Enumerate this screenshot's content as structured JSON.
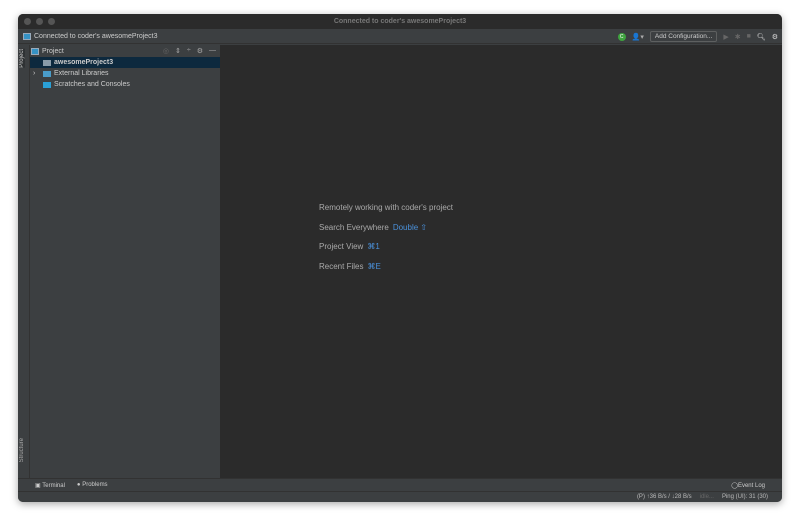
{
  "window": {
    "title": "Connected to coder's awesomeProject3"
  },
  "toolbar": {
    "project_label": "Connected to coder's awesomeProject3",
    "status_letter": "C",
    "add_configuration": "Add Configuration..."
  },
  "left_stripe": {
    "project_tab": "Project",
    "structure_tab": "Structure"
  },
  "project_panel": {
    "title": "Project",
    "items": [
      {
        "label": "awesomeProject3"
      },
      {
        "label": "External Libraries"
      },
      {
        "label": "Scratches and Consoles"
      }
    ]
  },
  "editor": {
    "heading": "Remotely working with coder's project",
    "hints": [
      {
        "label": "Search Everywhere",
        "shortcut": "Double ⇧"
      },
      {
        "label": "Project View",
        "shortcut": "⌘1"
      },
      {
        "label": "Recent Files",
        "shortcut": "⌘E"
      }
    ]
  },
  "bottom_bar": {
    "terminal": "Terminal",
    "problems": "Problems",
    "event_log": "Event Log"
  },
  "status_bar": {
    "traffic": "(P) ↑36 B/s / ↓28 B/s",
    "state": "idle...",
    "ping": "Ping (UI): 31 (30)"
  }
}
